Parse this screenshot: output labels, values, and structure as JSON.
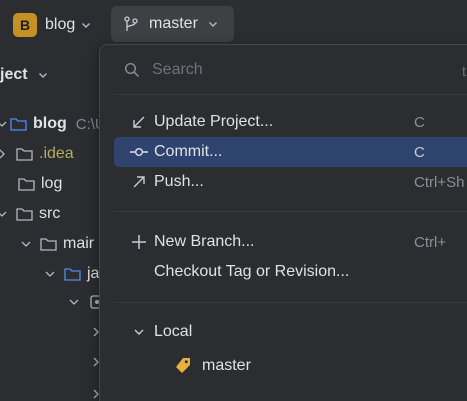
{
  "toolbar": {
    "project_badge": "B",
    "project_name": "blog",
    "branch_name": "master"
  },
  "project_panel": {
    "title": "ject",
    "tree": [
      {
        "label": "blog",
        "suffix": "C:\\U"
      },
      {
        "label": ".idea"
      },
      {
        "label": "log"
      },
      {
        "label": "src"
      },
      {
        "label": "mair"
      },
      {
        "label": "ja"
      },
      {
        "label": ""
      },
      {
        "label": ""
      },
      {
        "label": ""
      }
    ]
  },
  "popup": {
    "search_placeholder": "Search",
    "search_hint": "t",
    "items": [
      {
        "label": "Update Project...",
        "shortcut": "C"
      },
      {
        "label": "Commit...",
        "shortcut": "C"
      },
      {
        "label": "Push...",
        "shortcut": "Ctrl+Sh"
      },
      {
        "label": "New Branch...",
        "shortcut": "Ctrl+"
      },
      {
        "label": "Checkout Tag or Revision...",
        "shortcut": ""
      }
    ],
    "local_section": "Local",
    "local_branch": "master"
  },
  "colors": {
    "selected": "#2e436e",
    "badge": "#c79023",
    "tag": "#e8b03c",
    "idea_text": "#b3ae60"
  }
}
